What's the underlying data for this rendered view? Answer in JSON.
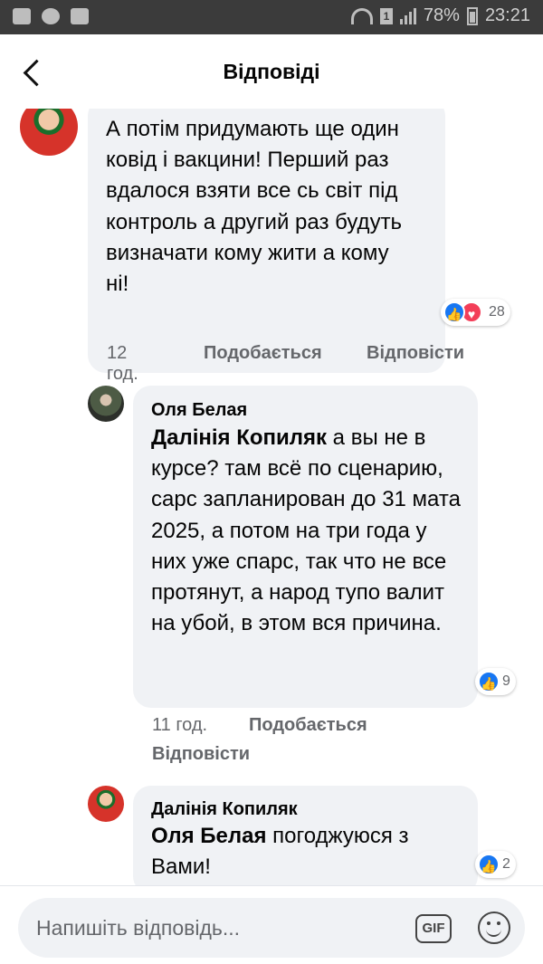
{
  "status_bar": {
    "battery": "78%",
    "time": "23:21",
    "sim": "1",
    "icons": [
      "image-icon",
      "shield-icon",
      "folder-icon",
      "wifi-icon",
      "sim-icon",
      "signal-icon",
      "battery-icon"
    ]
  },
  "header": {
    "title": "Відповіді",
    "back_icon": "chevron-left-icon"
  },
  "comments": [
    {
      "author": "",
      "text": "А потім придумають ще один ковід і вакцини! Перший раз вдалося взяти все сь світ під контроль а другий раз будуть визначати кому жити а кому ні!",
      "reactions": {
        "like": true,
        "love": true,
        "count": "28"
      },
      "time": "12 год.",
      "like_label": "Подобається",
      "reply_label": "Відповісти"
    },
    {
      "author": "Оля Белая",
      "mention": "Далінія Копиляк",
      "text": " а вы не в курсе? там всё по сценарию, сарс запланирован до 31 мата 2025, а потом на три года у них уже спарс, так что не все протянут, а народ тупо валит на убой, в этом вся причина.",
      "reactions": {
        "like": true,
        "love": false,
        "count": "9"
      },
      "time": "11 год.",
      "like_label": "Подобається",
      "reply_label": "Відповісти"
    },
    {
      "author": "Далінія Копиляк",
      "mention": "Оля Белая",
      "text": " погоджуюся з Вами!",
      "reactions": {
        "like": true,
        "love": false,
        "count": "2"
      }
    }
  ],
  "composer": {
    "placeholder": "Напишіть відповідь...",
    "gif_label": "GIF",
    "emoji_icon": "smiley-icon"
  },
  "colors": {
    "bubble": "#f0f2f5",
    "like": "#1877f2",
    "love": "#f33e58",
    "meta": "#65676b"
  }
}
